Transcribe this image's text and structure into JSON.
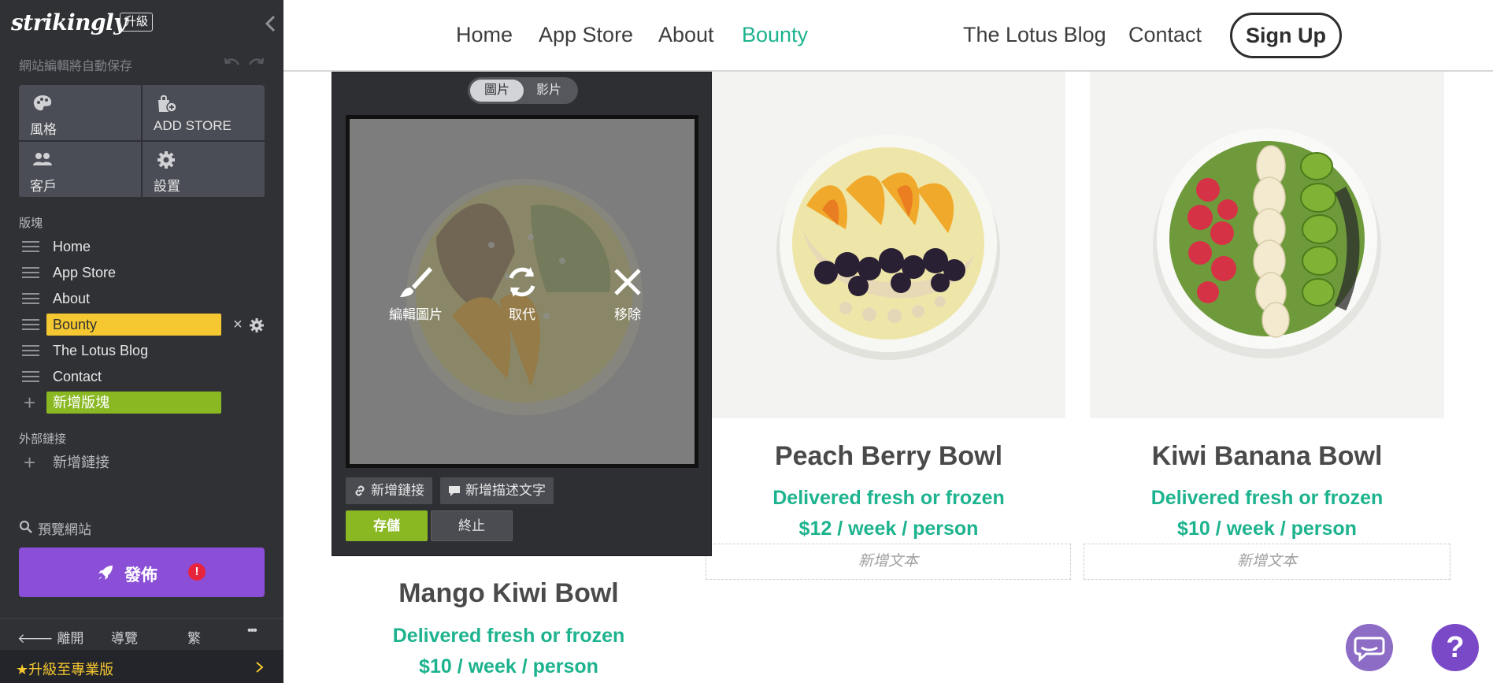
{
  "editor": {
    "logo": "strikingly",
    "upgrade_badge": "升級",
    "autosave": "網站編輯將自動保存",
    "tiles": [
      {
        "label": "風格",
        "icon": "palette-icon"
      },
      {
        "label": "ADD STORE",
        "icon": "store-icon"
      },
      {
        "label": "客戶",
        "icon": "users-icon"
      },
      {
        "label": "設置",
        "icon": "gear-icon"
      }
    ],
    "sections_label": "版塊",
    "pages": [
      {
        "label": "Home"
      },
      {
        "label": "App Store"
      },
      {
        "label": "About"
      },
      {
        "label": "Bounty",
        "active": true
      },
      {
        "label": "The Lotus Blog"
      },
      {
        "label": "Contact"
      }
    ],
    "add_section": "新增版塊",
    "external_links_label": "外部鏈接",
    "add_link": "新增鏈接",
    "preview": "預覽網站",
    "publish": "發佈",
    "publish_alert": "!",
    "bottom": {
      "leave": "離開",
      "guide": "導覽",
      "lang": "繁",
      "more": "•••"
    },
    "upgrade_pro": "★升級至專業版",
    "colors": {
      "sidebar": "#2f3135",
      "active_page": "#f5c730",
      "add_green": "#8ab823",
      "publish_purple": "#8a4fd6"
    }
  },
  "site": {
    "nav": [
      "Home",
      "App Store",
      "About",
      "Bounty",
      "The Lotus Blog",
      "Contact"
    ],
    "active_nav": "Bounty",
    "signup": "Sign Up",
    "accent_color": "#1db38e",
    "products": [
      {
        "title": "Mango Kiwi Bowl",
        "tagline": "Delivered fresh or frozen",
        "price": "$10 / week / person"
      },
      {
        "title": "Peach Berry Bowl",
        "tagline": "Delivered fresh or frozen",
        "price": "$12 / week / person",
        "add_text": "新增文本"
      },
      {
        "title": "Kiwi Banana Bowl",
        "tagline": "Delivered fresh or frozen",
        "price": "$10 / week / person",
        "add_text": "新增文本"
      }
    ]
  },
  "image_editor": {
    "tab_image": "圖片",
    "tab_video": "影片",
    "edit_image": "編輯圖片",
    "replace": "取代",
    "remove": "移除",
    "add_link": "新增鏈接",
    "add_description": "新增描述文字",
    "save": "存儲",
    "cancel": "終止"
  },
  "widgets": {
    "help": "?"
  }
}
